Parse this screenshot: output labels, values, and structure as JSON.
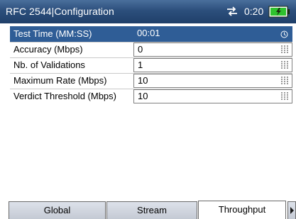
{
  "titlebar": {
    "title": "RFC 2544|Configuration",
    "clock": "0:20",
    "colors": {
      "background": "#2c4f7c",
      "battery": "#2ec22e"
    }
  },
  "rows": [
    {
      "label": "Test Time (MM:SS)",
      "value": "00:01",
      "selected": true
    },
    {
      "label": "Accuracy (Mbps)",
      "value": "0"
    },
    {
      "label": "Nb. of Validations",
      "value": "1"
    },
    {
      "label": "Maximum Rate (Mbps)",
      "value": "10"
    },
    {
      "label": "Verdict Threshold (Mbps)",
      "value": "10"
    }
  ],
  "tabs": [
    {
      "label": "Global"
    },
    {
      "label": "Stream"
    },
    {
      "label": "Throughput",
      "active": true
    }
  ],
  "colors": {
    "selection": "#2f5d96",
    "tab_fill": "#d3d8e0"
  }
}
